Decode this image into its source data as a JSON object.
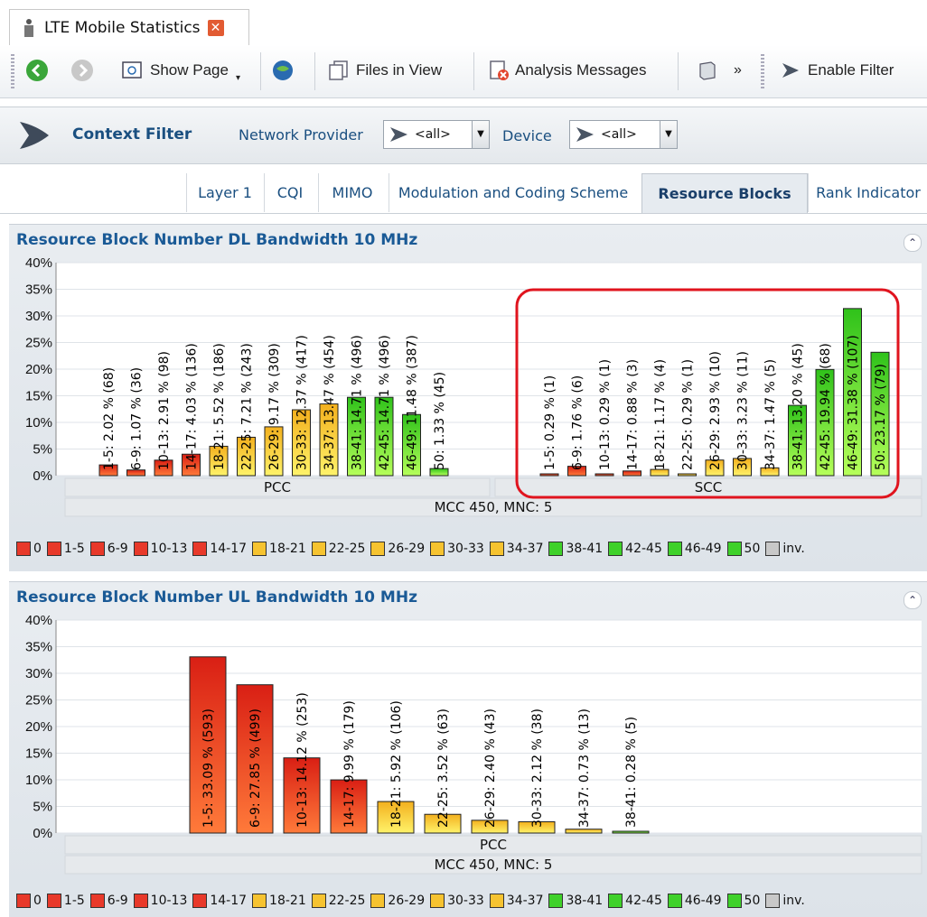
{
  "window": {
    "tab_title": "LTE Mobile Statistics",
    "close_symbol": "✕"
  },
  "toolbar": {
    "show_page": "Show Page",
    "files_in_view": "Files in View",
    "analysis_messages": "Analysis Messages",
    "overflow": "»",
    "enable_filter": "Enable Filter"
  },
  "context_filter": {
    "label": "Context Filter",
    "network_provider_label": "Network Provider",
    "network_provider_value": "<all>",
    "device_label": "Device",
    "device_value": "<all>"
  },
  "tabs": [
    {
      "label": "Layer 1",
      "active": false
    },
    {
      "label": "CQI",
      "active": false
    },
    {
      "label": "MIMO",
      "active": false
    },
    {
      "label": "Modulation and Coding Scheme",
      "active": false
    },
    {
      "label": "Resource Blocks",
      "active": true
    },
    {
      "label": "Rank Indicator",
      "active": false
    }
  ],
  "legend_items": [
    {
      "label": "0",
      "color": "#e8392a"
    },
    {
      "label": "1-5",
      "color": "#e8392a"
    },
    {
      "label": "6-9",
      "color": "#e8392a"
    },
    {
      "label": "10-13",
      "color": "#e8392a"
    },
    {
      "label": "14-17",
      "color": "#e8392a"
    },
    {
      "label": "18-21",
      "color": "#f6c330"
    },
    {
      "label": "22-25",
      "color": "#f6c330"
    },
    {
      "label": "26-29",
      "color": "#f6c330"
    },
    {
      "label": "30-33",
      "color": "#f6c330"
    },
    {
      "label": "34-37",
      "color": "#f6c330"
    },
    {
      "label": "38-41",
      "color": "#3fd12a"
    },
    {
      "label": "42-45",
      "color": "#3fd12a"
    },
    {
      "label": "46-49",
      "color": "#3fd12a"
    },
    {
      "label": "50",
      "color": "#3fd12a"
    },
    {
      "label": "inv.",
      "color": "#c8c8c8"
    }
  ],
  "chart_data": [
    {
      "type": "bar",
      "title": "Resource Block Number DL Bandwidth 10 MHz",
      "yticks": [
        "40%",
        "35%",
        "30%",
        "25%",
        "20%",
        "15%",
        "10%",
        "5%",
        "0%"
      ],
      "ylim": [
        0,
        40
      ],
      "group_label": "MCC 450, MNC: 5",
      "highlight_group": "SCC",
      "groups": [
        {
          "name": "PCC",
          "bars": [
            {
              "label": "1-5: 2.02 % (68)",
              "value": 2.02,
              "color": "red"
            },
            {
              "label": "6-9: 1.07 % (36)",
              "value": 1.07,
              "color": "red"
            },
            {
              "label": "10-13: 2.91 % (98)",
              "value": 2.91,
              "color": "red"
            },
            {
              "label": "14-17: 4.03 % (136)",
              "value": 4.03,
              "color": "red"
            },
            {
              "label": "18-21: 5.52 % (186)",
              "value": 5.52,
              "color": "yellow"
            },
            {
              "label": "22-25: 7.21 % (243)",
              "value": 7.21,
              "color": "yellow"
            },
            {
              "label": "26-29: 9.17 % (309)",
              "value": 9.17,
              "color": "yellow"
            },
            {
              "label": "30-33: 12.37 % (417)",
              "value": 12.37,
              "color": "yellow"
            },
            {
              "label": "34-37: 13.47 % (454)",
              "value": 13.47,
              "color": "yellow"
            },
            {
              "label": "38-41: 14.71 % (496)",
              "value": 14.71,
              "color": "green"
            },
            {
              "label": "42-45: 14.71 % (496)",
              "value": 14.71,
              "color": "green"
            },
            {
              "label": "46-49: 11.48 % (387)",
              "value": 11.48,
              "color": "green"
            },
            {
              "label": "50: 1.33 % (45)",
              "value": 1.33,
              "color": "green"
            }
          ]
        },
        {
          "name": "SCC",
          "bars": [
            {
              "label": "1-5: 0.29 % (1)",
              "value": 0.29,
              "color": "red"
            },
            {
              "label": "6-9: 1.76 % (6)",
              "value": 1.76,
              "color": "red"
            },
            {
              "label": "10-13: 0.29 % (1)",
              "value": 0.29,
              "color": "red"
            },
            {
              "label": "14-17: 0.88 % (3)",
              "value": 0.88,
              "color": "red"
            },
            {
              "label": "18-21: 1.17 % (4)",
              "value": 1.17,
              "color": "yellow"
            },
            {
              "label": "22-25: 0.29 % (1)",
              "value": 0.29,
              "color": "yellow"
            },
            {
              "label": "26-29: 2.93 % (10)",
              "value": 2.93,
              "color": "yellow"
            },
            {
              "label": "30-33: 3.23 % (11)",
              "value": 3.23,
              "color": "yellow"
            },
            {
              "label": "34-37: 1.47 % (5)",
              "value": 1.47,
              "color": "yellow"
            },
            {
              "label": "38-41: 13.20 % (45)",
              "value": 13.2,
              "color": "green"
            },
            {
              "label": "42-45: 19.94 % (68)",
              "value": 19.94,
              "color": "green"
            },
            {
              "label": "46-49: 31.38 % (107)",
              "value": 31.38,
              "color": "green"
            },
            {
              "label": "50: 23.17 % (79)",
              "value": 23.17,
              "color": "green"
            }
          ]
        }
      ]
    },
    {
      "type": "bar",
      "title": "Resource Block Number UL Bandwidth 10 MHz",
      "yticks": [
        "40%",
        "35%",
        "30%",
        "25%",
        "20%",
        "15%",
        "10%",
        "5%",
        "0%"
      ],
      "ylim": [
        0,
        40
      ],
      "group_label": "MCC 450, MNC: 5",
      "groups": [
        {
          "name": "PCC",
          "bars": [
            {
              "label": "1-5: 33.09 % (593)",
              "value": 33.09,
              "color": "red"
            },
            {
              "label": "6-9: 27.85 % (499)",
              "value": 27.85,
              "color": "red"
            },
            {
              "label": "10-13: 14.12 % (253)",
              "value": 14.12,
              "color": "red"
            },
            {
              "label": "14-17: 9.99 % (179)",
              "value": 9.99,
              "color": "red"
            },
            {
              "label": "18-21: 5.92 % (106)",
              "value": 5.92,
              "color": "yellow"
            },
            {
              "label": "22-25: 3.52 % (63)",
              "value": 3.52,
              "color": "yellow"
            },
            {
              "label": "26-29: 2.40 % (43)",
              "value": 2.4,
              "color": "yellow"
            },
            {
              "label": "30-33: 2.12 % (38)",
              "value": 2.12,
              "color": "yellow"
            },
            {
              "label": "34-37: 0.73 % (13)",
              "value": 0.73,
              "color": "yellow"
            },
            {
              "label": "38-41: 0.28 % (5)",
              "value": 0.28,
              "color": "green"
            }
          ]
        }
      ]
    }
  ]
}
